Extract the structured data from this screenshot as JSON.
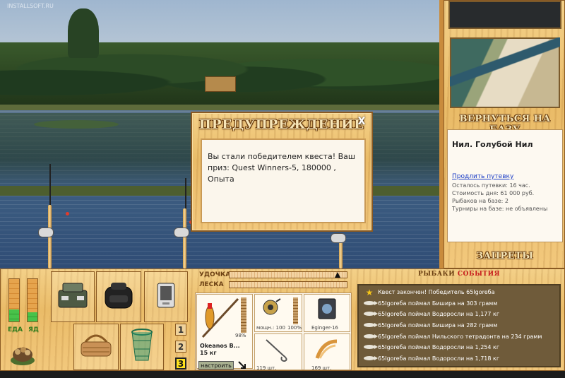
{
  "scene": {
    "watermark": "INSTALLSOFT.RU"
  },
  "dialog": {
    "title": "ПРЕДУПРЕЖДЕНИЕ",
    "close": "X",
    "message": "Вы стали победителем квеста! Ваш приз: Quest Winners-5, 180000 , Опыта"
  },
  "right_panel": {
    "return_label": "ВЕРНУТЬСЯ НА БАЗУ",
    "base_name": "Нил. Голубой Нил",
    "extend_link": "Продлить путевку",
    "lines": [
      "Осталось путевки: 16 час.",
      "Стоимость дня: 61 000 руб.",
      "Рыбаков на базе: 2",
      "Турниры на базе: не объявлены"
    ],
    "bans_label": "ЗАПРЕТЫ"
  },
  "player": {
    "food_label": "ЕДА",
    "drink_label": "ЯД",
    "food_level": 0.28,
    "drink_level": 0.22
  },
  "inventory": {
    "items": [
      "tackle-box",
      "backpack",
      "phone",
      "basket",
      "keepnet",
      "groundbait-bag"
    ]
  },
  "rod_slots": {
    "buttons": [
      "1",
      "2",
      "3"
    ],
    "active": "3"
  },
  "tension": {
    "rod_label": "УДОЧКА",
    "line_label": "ЛЕСКА",
    "rod_level": 0.94,
    "line_level": 0.0
  },
  "gear": {
    "rod_percent": "98%",
    "rod_name": "Okeanos B...",
    "rod_weight": "15 кг",
    "setup_button": "настроить",
    "reel_power": "мощн.: 100",
    "reel_percent": "100%",
    "line_name": "Eginger-16",
    "hook_count": "119 шт.",
    "bait_count": "169 шт."
  },
  "events": {
    "title_left": "РЫБАКИ",
    "title_right": "СОБЫТИЯ",
    "colors": {
      "title_left": "#6b3f12",
      "title_right": "#c81e1e"
    },
    "rows": [
      {
        "icon": "star",
        "text": "Квест закончен! Победитель 65Igoreба"
      },
      {
        "icon": "fish",
        "text": "65Igoreба поймал Бишира на 303 грамм"
      },
      {
        "icon": "fish",
        "text": "65Igoreба поймал Водоросли на 1,177 кг"
      },
      {
        "icon": "fish",
        "text": "65Igoreба поймал Бишира на 282 грамм"
      },
      {
        "icon": "fish",
        "text": "65Igoreба поймал Нильского тетрадонта на 234 грамм"
      },
      {
        "icon": "fish",
        "text": "65Igoreба поймал Водоросли на 1,254 кг"
      },
      {
        "icon": "fish",
        "text": "65Igoreба поймал Водоросли на 1,718 кг"
      }
    ]
  }
}
